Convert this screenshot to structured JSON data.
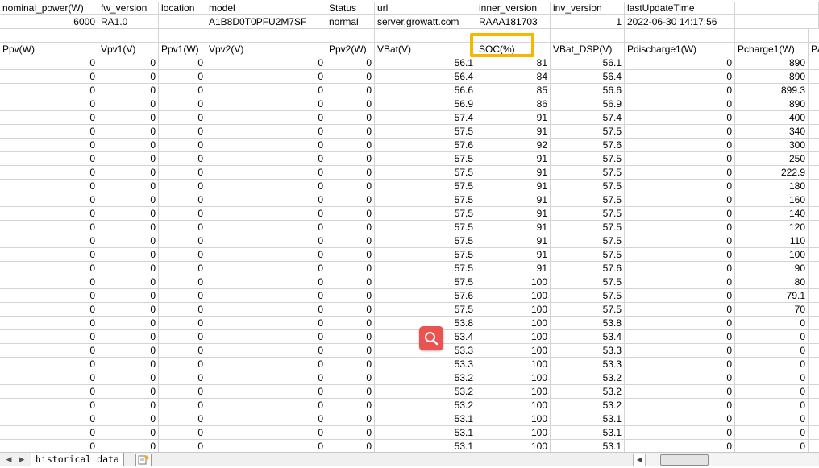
{
  "sheet": {
    "info_headers": [
      "nominal_power(W)",
      "fw_version",
      "location",
      "model",
      "Status",
      "url",
      "inner_version",
      "inv_version",
      "lastUpdateTime"
    ],
    "info_values": [
      "6000",
      "RA1.0",
      "",
      "A1B8D0T0PFU2M7SF",
      "normal",
      "server.growatt.com",
      "RAAA181703",
      "1",
      "2022-06-30 14:17:56"
    ],
    "data_headers": [
      "Ppv(W)",
      "Vpv1(V)",
      "Ppv1(W)",
      "Vpv2(V)",
      "Ppv2(W)",
      "VBat(V)",
      "SOC(%)",
      "VBat_DSP(V)",
      "Pdischarge1(W)",
      "Pcharge1(W)",
      "Pa"
    ],
    "rows": [
      [
        "0",
        "0",
        "0",
        "0",
        "0",
        "56.1",
        "81",
        "56.1",
        "0",
        "890"
      ],
      [
        "0",
        "0",
        "0",
        "0",
        "0",
        "56.4",
        "84",
        "56.4",
        "0",
        "890"
      ],
      [
        "0",
        "0",
        "0",
        "0",
        "0",
        "56.6",
        "85",
        "56.6",
        "0",
        "899.3"
      ],
      [
        "0",
        "0",
        "0",
        "0",
        "0",
        "56.9",
        "86",
        "56.9",
        "0",
        "890"
      ],
      [
        "0",
        "0",
        "0",
        "0",
        "0",
        "57.4",
        "91",
        "57.4",
        "0",
        "400"
      ],
      [
        "0",
        "0",
        "0",
        "0",
        "0",
        "57.5",
        "91",
        "57.5",
        "0",
        "340"
      ],
      [
        "0",
        "0",
        "0",
        "0",
        "0",
        "57.6",
        "92",
        "57.6",
        "0",
        "300"
      ],
      [
        "0",
        "0",
        "0",
        "0",
        "0",
        "57.5",
        "91",
        "57.5",
        "0",
        "250"
      ],
      [
        "0",
        "0",
        "0",
        "0",
        "0",
        "57.5",
        "91",
        "57.5",
        "0",
        "222.9"
      ],
      [
        "0",
        "0",
        "0",
        "0",
        "0",
        "57.5",
        "91",
        "57.5",
        "0",
        "180"
      ],
      [
        "0",
        "0",
        "0",
        "0",
        "0",
        "57.5",
        "91",
        "57.5",
        "0",
        "160"
      ],
      [
        "0",
        "0",
        "0",
        "0",
        "0",
        "57.5",
        "91",
        "57.5",
        "0",
        "140"
      ],
      [
        "0",
        "0",
        "0",
        "0",
        "0",
        "57.5",
        "91",
        "57.5",
        "0",
        "120"
      ],
      [
        "0",
        "0",
        "0",
        "0",
        "0",
        "57.5",
        "91",
        "57.5",
        "0",
        "110"
      ],
      [
        "0",
        "0",
        "0",
        "0",
        "0",
        "57.5",
        "91",
        "57.5",
        "0",
        "100"
      ],
      [
        "0",
        "0",
        "0",
        "0",
        "0",
        "57.5",
        "91",
        "57.6",
        "0",
        "90"
      ],
      [
        "0",
        "0",
        "0",
        "0",
        "0",
        "57.5",
        "100",
        "57.5",
        "0",
        "80"
      ],
      [
        "0",
        "0",
        "0",
        "0",
        "0",
        "57.6",
        "100",
        "57.5",
        "0",
        "79.1"
      ],
      [
        "0",
        "0",
        "0",
        "0",
        "0",
        "57.5",
        "100",
        "57.5",
        "0",
        "70"
      ],
      [
        "0",
        "0",
        "0",
        "0",
        "0",
        "53.8",
        "100",
        "53.8",
        "0",
        "0"
      ],
      [
        "0",
        "0",
        "0",
        "0",
        "0",
        "53.4",
        "100",
        "53.4",
        "0",
        "0"
      ],
      [
        "0",
        "0",
        "0",
        "0",
        "0",
        "53.3",
        "100",
        "53.3",
        "0",
        "0"
      ],
      [
        "0",
        "0",
        "0",
        "0",
        "0",
        "53.3",
        "100",
        "53.3",
        "0",
        "0"
      ],
      [
        "0",
        "0",
        "0",
        "0",
        "0",
        "53.2",
        "100",
        "53.2",
        "0",
        "0"
      ],
      [
        "0",
        "0",
        "0",
        "0",
        "0",
        "53.2",
        "100",
        "53.2",
        "0",
        "0"
      ],
      [
        "0",
        "0",
        "0",
        "0",
        "0",
        "53.2",
        "100",
        "53.2",
        "0",
        "0"
      ],
      [
        "0",
        "0",
        "0",
        "0",
        "0",
        "53.1",
        "100",
        "53.1",
        "0",
        "0"
      ],
      [
        "0",
        "0",
        "0",
        "0",
        "0",
        "53.1",
        "100",
        "53.1",
        "0",
        "0"
      ],
      [
        "0",
        "0",
        "0",
        "0",
        "0",
        "53.1",
        "100",
        "53.1",
        "0",
        "0"
      ]
    ]
  },
  "tabs": {
    "sheet_name": "historical data",
    "nav_left": "◀",
    "nav_right": "▶",
    "scroll_left": "◀"
  },
  "highlight": {
    "target": "SOC(%)",
    "color": "#f7b700"
  },
  "zoom_button": {
    "icon": "search-icon",
    "color": "#ea5350"
  }
}
